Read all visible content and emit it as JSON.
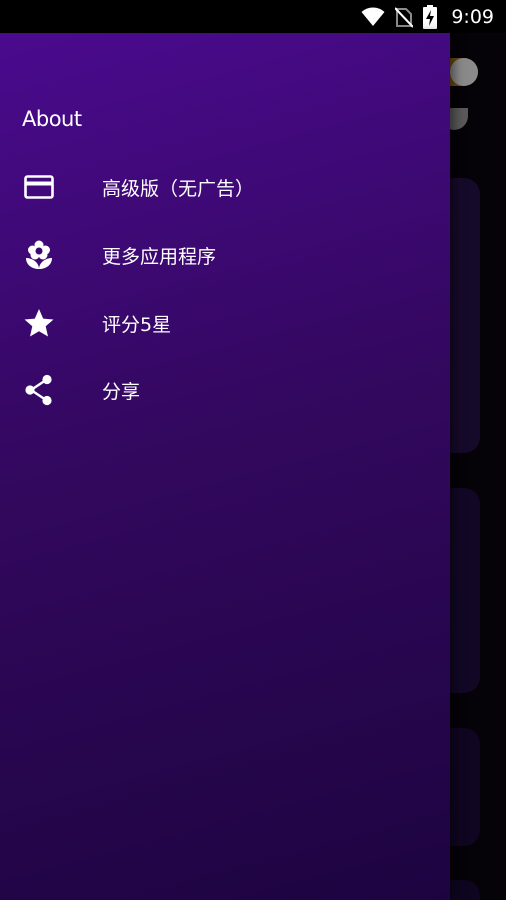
{
  "status_bar": {
    "time": "9:09",
    "icons": [
      "wifi-icon",
      "no-sim-icon",
      "battery-charging-icon"
    ]
  },
  "drawer": {
    "title": "About",
    "items": [
      {
        "label": "高级版（无广告）",
        "icon": "credit-card-icon"
      },
      {
        "label": "更多应用程序",
        "icon": "flower-icon"
      },
      {
        "label": "评分5星",
        "icon": "star-icon"
      },
      {
        "label": "分享",
        "icon": "share-icon"
      }
    ]
  }
}
